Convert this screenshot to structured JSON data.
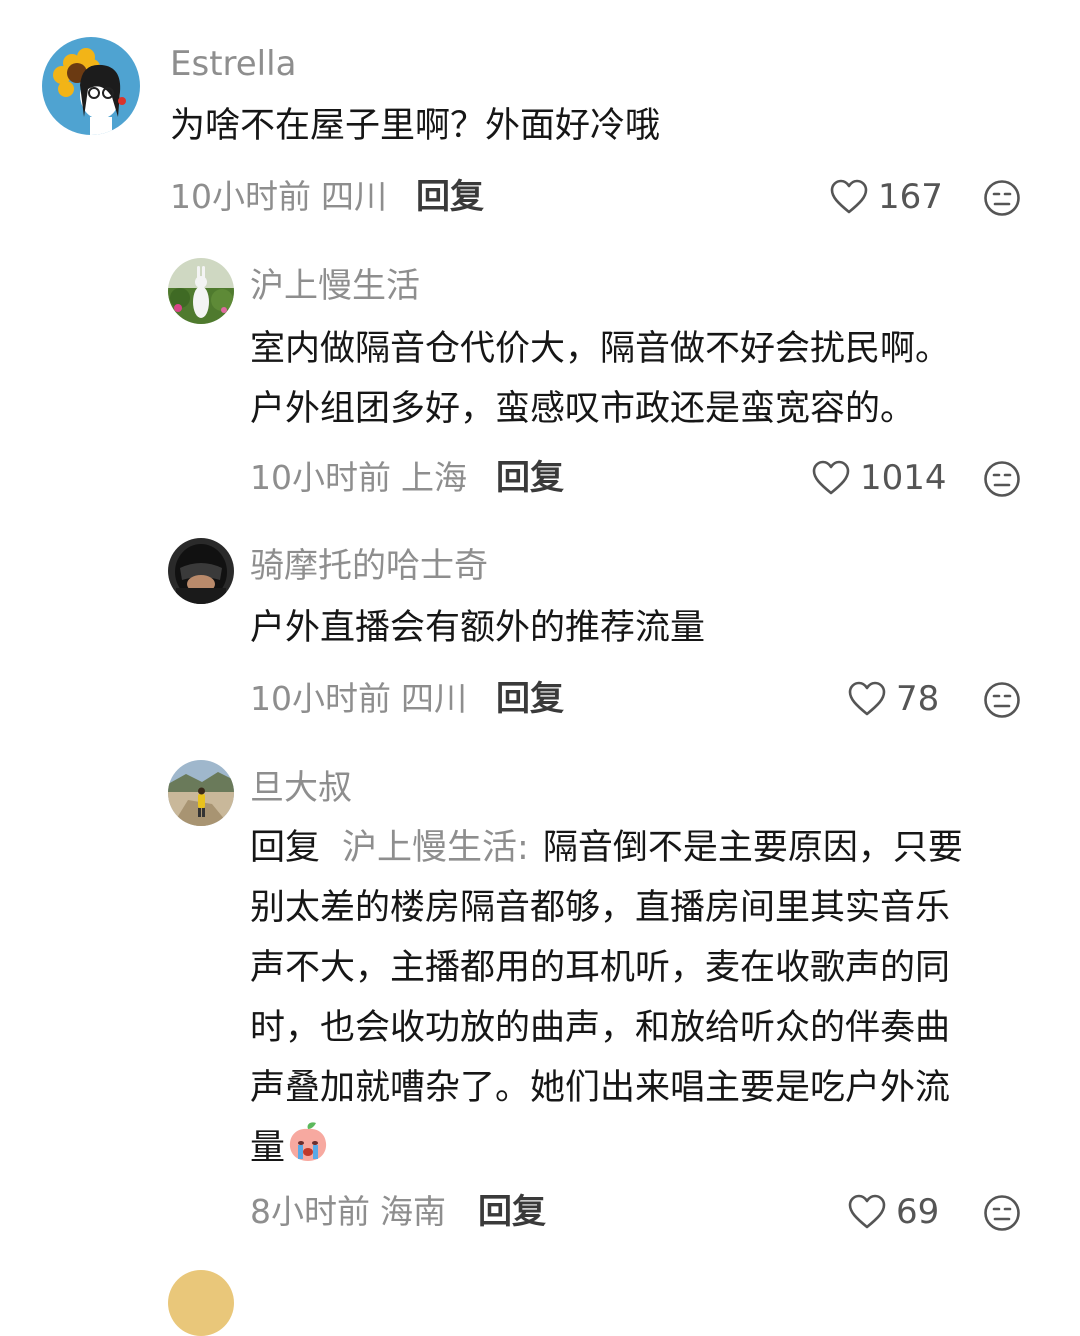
{
  "comments": [
    {
      "name": "Estrella",
      "text": "为啥不在屋子里啊？外面好冷哦",
      "time": "10小时前",
      "region": "四川",
      "reply_label": "回复",
      "likes": "167",
      "avatar_icon": "sunflower-girl-avatar"
    },
    {
      "name": "沪上慢生活",
      "text_line1": "室内做隔音仓代价大，隔音做不好会扰民啊。",
      "text_line2": "户外组团多好，蛮感叹市政还是蛮宽容的。",
      "time": "10小时前",
      "region": "上海",
      "reply_label": "回复",
      "likes": "1014",
      "avatar_icon": "rabbit-statue-avatar"
    },
    {
      "name": "骑摩托的哈士奇",
      "text": "户外直播会有额外的推荐流量",
      "time": "10小时前",
      "region": "四川",
      "reply_label": "回复",
      "likes": "78",
      "avatar_icon": "helmet-rider-avatar"
    },
    {
      "name": "旦大叔",
      "reply_prefix": "回复",
      "reply_to": "沪上慢生活",
      "reply_colon": ":",
      "lines": [
        "隔音倒不是主要原因，只要",
        "别太差的楼房隔音都够，直播房间里其实音乐",
        "声不大，主播都用的耳机听，麦在收歌声的同",
        "时，也会收功放的曲声，和放给听众的伴奏曲",
        "声叠加就嘈杂了。她们出来唱主要是吃户外流",
        "量"
      ],
      "emoji_icon": "crying-peach-emoji",
      "time": "8小时前",
      "region": "海南",
      "reply_label": "回复",
      "likes": "69",
      "avatar_icon": "mountain-hiker-avatar"
    }
  ],
  "colors": {
    "text": "#161616",
    "secondary": "#8e8e8e",
    "reply": "#3a3a3a"
  }
}
